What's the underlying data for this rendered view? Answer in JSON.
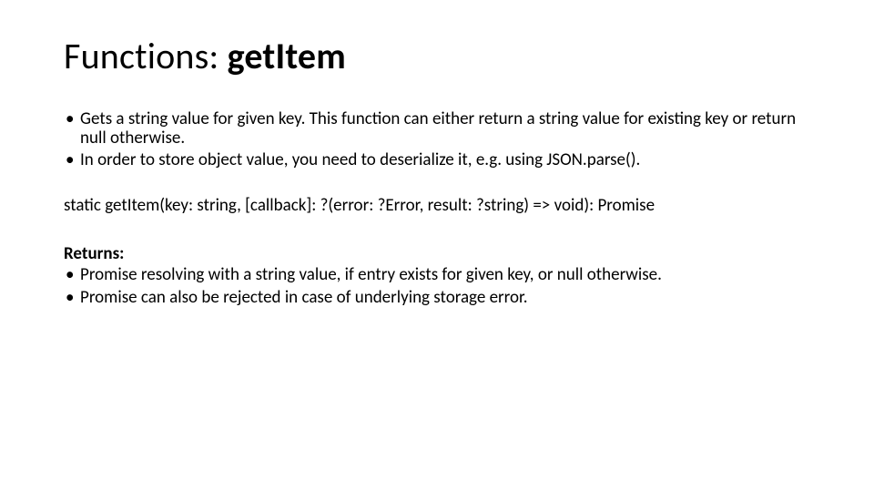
{
  "title": {
    "prefix": "Functions: ",
    "fn_name": "getItem"
  },
  "description": {
    "items": [
      "Gets a string value for given key. This function can either return a string value for existing key or return null otherwise.",
      "In order to store object value, you need to deserialize it, e.g. using JSON.parse()."
    ]
  },
  "signature": "static getItem(key: string, [callback]: ?(error: ?Error, result: ?string) => void): Promise",
  "returns": {
    "label": "Returns:",
    "items": [
      "Promise resolving with a string value, if entry exists for given key, or null otherwise.",
      "Promise can also be rejected in case of underlying storage error."
    ]
  }
}
